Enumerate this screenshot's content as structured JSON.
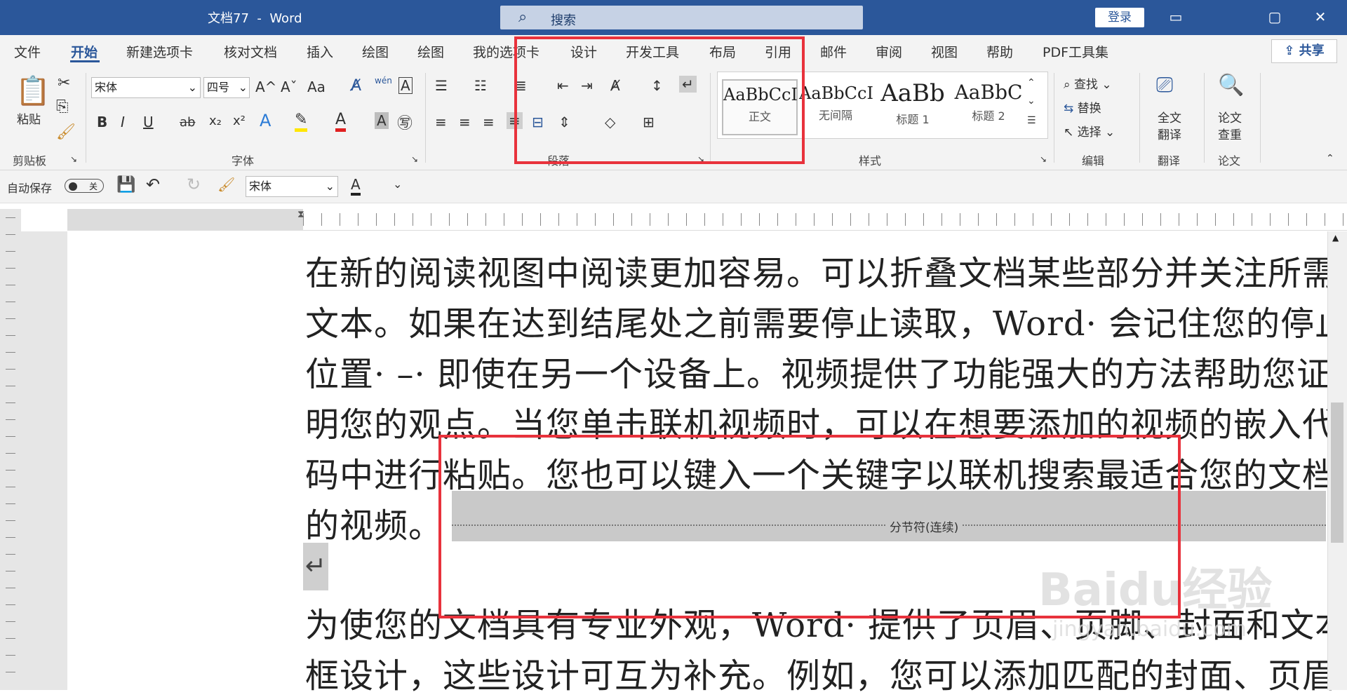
{
  "window": {
    "doc_title": "文档77",
    "separator": "-",
    "app_name": "Word",
    "search_label": "搜索",
    "login_label": "登录",
    "controls": [
      "▭",
      "▢",
      "✕"
    ]
  },
  "tabs": [
    {
      "label": "文件"
    },
    {
      "label": "开始"
    },
    {
      "label": "新建选项卡"
    },
    {
      "label": "核对文档"
    },
    {
      "label": "插入"
    },
    {
      "label": "绘图"
    },
    {
      "label": "绘图"
    },
    {
      "label": "我的选项卡"
    },
    {
      "label": "设计"
    },
    {
      "label": "开发工具"
    },
    {
      "label": "布局"
    },
    {
      "label": "引用"
    },
    {
      "label": "邮件"
    },
    {
      "label": "审阅"
    },
    {
      "label": "视图"
    },
    {
      "label": "帮助"
    },
    {
      "label": "PDF工具集"
    }
  ],
  "active_tab": "开始",
  "share_label": "共享",
  "ribbon": {
    "clipboard": {
      "paste": "粘贴",
      "group": "剪贴板"
    },
    "font": {
      "name": "宋体",
      "size": "四号",
      "group": "字体",
      "grow": "A^",
      "shrink": "Aˇ",
      "case": "Aa",
      "phonetic": "wén",
      "bold": "B",
      "italic": "I",
      "underline": "U",
      "strike": "ab",
      "sub": "x₂",
      "sup": "x²"
    },
    "paragraph": {
      "group": "段落"
    },
    "styles": {
      "group": "样式",
      "items": [
        {
          "sample": "AaBbCcI",
          "name": "正文"
        },
        {
          "sample": "AaBbCcI",
          "name": "无间隔"
        },
        {
          "sample": "AaBb",
          "name": "标题 1"
        },
        {
          "sample": "AaBbC",
          "name": "标题 2"
        }
      ]
    },
    "editing": {
      "find": "查找",
      "replace": "替换",
      "select": "选择",
      "group": "编辑"
    },
    "translate": {
      "line1": "全文",
      "line2": "翻译",
      "group": "翻译"
    },
    "paper": {
      "line1": "论文",
      "line2": "查重",
      "group": "论文"
    }
  },
  "qat": {
    "autosave_label": "自动保存",
    "autosave_state": "关",
    "font": "宋体"
  },
  "document": {
    "lines": [
      "在新的阅读视图中阅读更加容易。可以折叠文档某些部分并关注所需",
      "文本。如果在达到结尾处之前需要停止读取，Word· 会记住您的停止",
      "位置· –· 即使在另一个设备上。视频提供了功能强大的方法帮助您证",
      "明您的观点。当您单击联机视频时，可以在想要添加的视频的嵌入代",
      "码中进行粘贴。您也可以键入一个关键字以联机搜索最适合您的文档",
      "的视频。"
    ],
    "section_break": "分节符(连续)",
    "lines2": [
      "为使您的文档具有专业外观，Word· 提供了页眉、页脚、封面和文本",
      "框设计，这些设计可互为补充。例如，您可以添加匹配的封面、页眉"
    ]
  },
  "watermark": {
    "brand": "Baidu经验",
    "url": "jingyan.baidu.com"
  },
  "colors": {
    "title_bar": "#2b579a",
    "highlight": "#e8323c"
  }
}
